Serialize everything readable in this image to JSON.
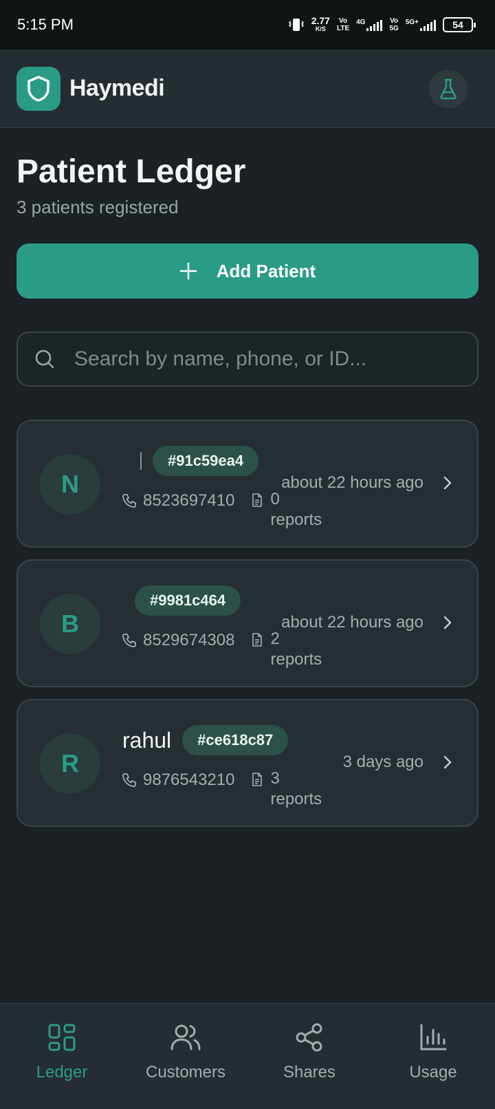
{
  "status_bar": {
    "time": "5:15 PM",
    "net_speed": "2.77",
    "net_unit": "K/S",
    "vo_lte_top": "Vo",
    "vo_lte_bottom": "LTE",
    "net_4g": "4G",
    "vo_5g_top": "Vo",
    "vo_5g_bottom": "5G",
    "net_5g": "5G+",
    "battery": "54"
  },
  "app": {
    "name": "Haymedi",
    "logo_icon": "shield-icon",
    "action_icon": "flask-icon",
    "accent_color": "#2a9c85"
  },
  "page": {
    "title": "Patient Ledger",
    "subtitle": "3 patients registered",
    "add_button": "Add Patient",
    "search_placeholder": "Search by name, phone, or ID..."
  },
  "patients": [
    {
      "initial": "N",
      "name": "",
      "id": "#91c59ea4",
      "phone": "8523697410",
      "reports_count": "0",
      "reports_label": "reports",
      "updated": "about 22 hours ago"
    },
    {
      "initial": "B",
      "name": "",
      "id": "#9981c464",
      "phone": "8529674308",
      "reports_count": "2",
      "reports_label": "reports",
      "updated": "about 22 hours ago"
    },
    {
      "initial": "R",
      "name": "rahul",
      "id": "#ce618c87",
      "phone": "9876543210",
      "reports_count": "3",
      "reports_label": "reports",
      "updated": "3 days ago"
    }
  ],
  "nav": [
    {
      "label": "Ledger",
      "icon": "grid-icon",
      "active": true
    },
    {
      "label": "Customers",
      "icon": "users-icon",
      "active": false
    },
    {
      "label": "Shares",
      "icon": "share-icon",
      "active": false
    },
    {
      "label": "Usage",
      "icon": "bar-chart-icon",
      "active": false
    }
  ]
}
